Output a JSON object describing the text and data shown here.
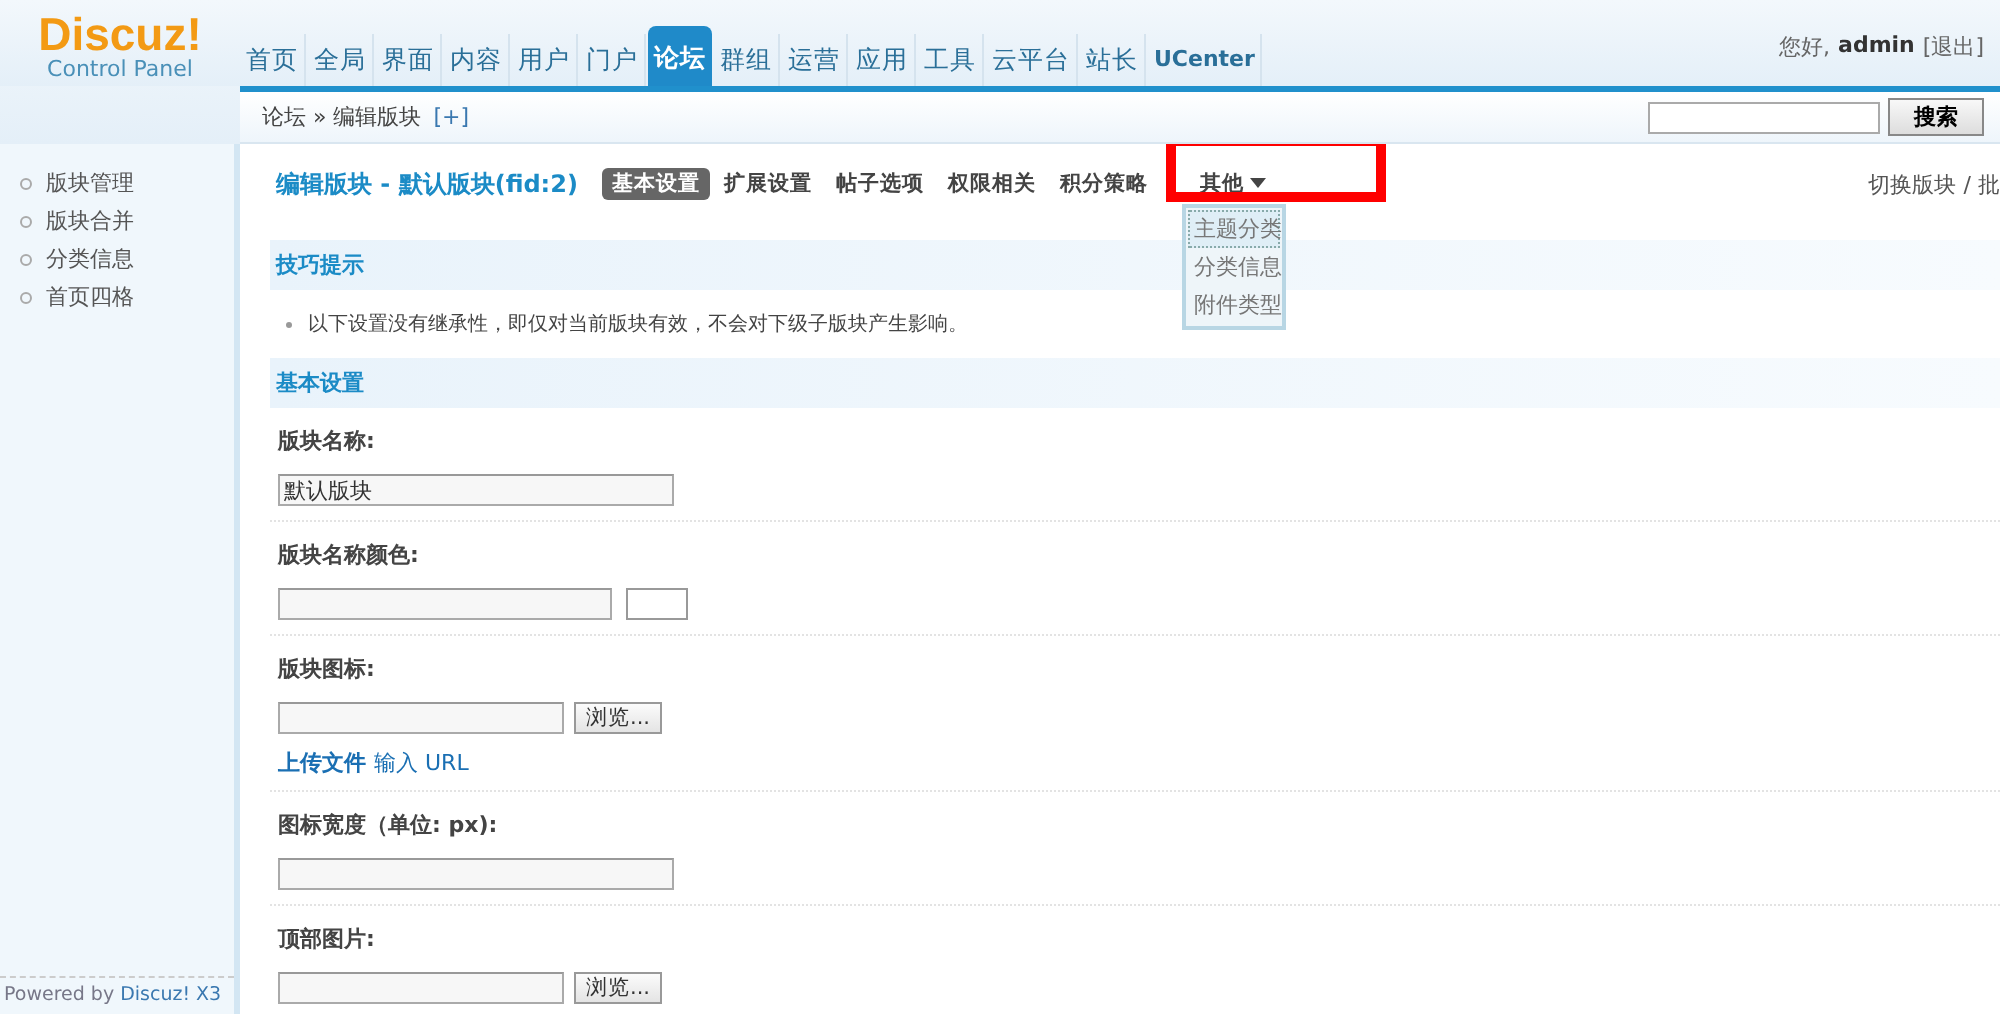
{
  "logo": {
    "title": "Discuz!",
    "subtitle": "Control Panel"
  },
  "nav": [
    {
      "label": "首页",
      "selected": false
    },
    {
      "label": "全局",
      "selected": false
    },
    {
      "label": "界面",
      "selected": false
    },
    {
      "label": "内容",
      "selected": false
    },
    {
      "label": "用户",
      "selected": false
    },
    {
      "label": "门户",
      "selected": false
    },
    {
      "label": "论坛",
      "selected": true
    },
    {
      "label": "群组",
      "selected": false
    },
    {
      "label": "运营",
      "selected": false
    },
    {
      "label": "应用",
      "selected": false
    },
    {
      "label": "工具",
      "selected": false
    },
    {
      "label": "云平台",
      "selected": false
    },
    {
      "label": "站长",
      "selected": false
    },
    {
      "label": "UCenter",
      "selected": false
    }
  ],
  "user": {
    "greeting": "您好,",
    "name": "admin",
    "logout": "[退出]"
  },
  "breadcrumb": {
    "path": "论坛 » 编辑版块",
    "add": "[+]"
  },
  "search": {
    "button": "搜索"
  },
  "sidebar": {
    "items": [
      {
        "label": "版块管理"
      },
      {
        "label": "版块合并"
      },
      {
        "label": "分类信息"
      },
      {
        "label": "首页四格"
      }
    ],
    "powered": "Powered by",
    "powered_link": "Discuz! X3"
  },
  "page": {
    "title": "编辑版块 - 默认版块(fid:2)",
    "tabs": [
      {
        "label": "基本设置",
        "selected": true,
        "kind": "tab"
      },
      {
        "label": "扩展设置",
        "selected": false,
        "kind": "tab"
      },
      {
        "label": "帖子选项",
        "selected": false,
        "kind": "tab"
      },
      {
        "label": "权限相关",
        "selected": false,
        "kind": "tab"
      },
      {
        "label": "积分策略",
        "selected": false,
        "kind": "tab"
      },
      {
        "label": "其他",
        "selected": false,
        "kind": "dropdown"
      }
    ],
    "dropdown": [
      {
        "label": "主题分类",
        "selected": true
      },
      {
        "label": "分类信息",
        "selected": false
      },
      {
        "label": "附件类型",
        "selected": false
      }
    ],
    "links": [
      "切换版块",
      "/ 批"
    ]
  },
  "tips": {
    "title": "技巧提示",
    "items": [
      "以下设置没有继承性，即仅对当前版块有效，不会对下级子版块产生影响。"
    ]
  },
  "section": {
    "title": "基本设置",
    "fields": [
      {
        "kind": "text",
        "label": "版块名称:",
        "value": "默认版块"
      },
      {
        "kind": "color",
        "label": "版块名称颜色:"
      },
      {
        "kind": "file",
        "label": "版块图标:",
        "browse": "浏览...",
        "links": [
          "上传文件",
          "输入 URL"
        ]
      },
      {
        "kind": "text",
        "label": "图标宽度（单位: px):"
      },
      {
        "kind": "file",
        "label": "顶部图片:",
        "browse": "浏览..."
      }
    ]
  }
}
